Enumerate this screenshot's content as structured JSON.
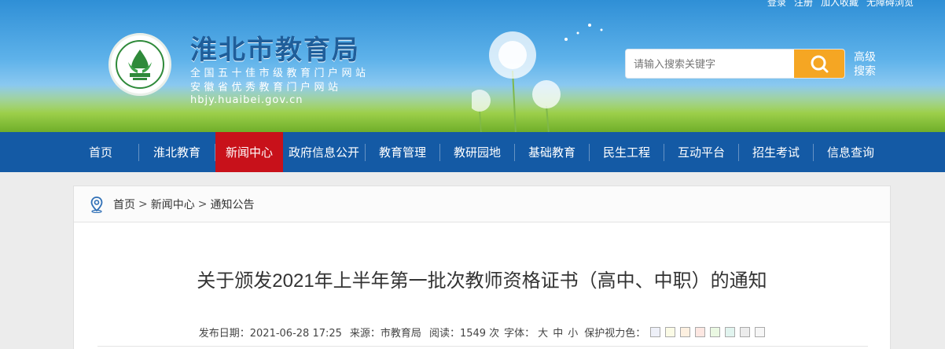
{
  "topbar": {
    "login": "登录",
    "register": "注册",
    "favorite": "加入收藏",
    "accessibility": "无障碍浏览"
  },
  "header": {
    "title": "淮北市教育局",
    "subtitle1": "全国五十佳市级教育门户网站",
    "subtitle2": "安徽省优秀教育门户网站",
    "domain": "hbjy.huaibei.gov.cn"
  },
  "search": {
    "placeholder": "请输入搜索关键字",
    "advanced": "高级搜索"
  },
  "nav": [
    {
      "label": "首页"
    },
    {
      "label": "淮北教育"
    },
    {
      "label": "新闻中心",
      "active": true
    },
    {
      "label": "政府信息公开"
    },
    {
      "label": "教育管理"
    },
    {
      "label": "教研园地"
    },
    {
      "label": "基础教育"
    },
    {
      "label": "民生工程"
    },
    {
      "label": "互动平台"
    },
    {
      "label": "招生考试"
    },
    {
      "label": "信息查询"
    }
  ],
  "breadcrumb": [
    "首页",
    "新闻中心",
    "通知公告"
  ],
  "breadcrumb_sep": ">",
  "article": {
    "title": "关于颁发2021年上半年第一批次教师资格证书（高中、中职）的通知",
    "publish_label": "发布日期：2021-06-28 17:25",
    "source_label": "来源：市教育局",
    "views_label": "阅读：1549 次",
    "font_label": "字体：",
    "font_options": [
      "大",
      "中",
      "小"
    ],
    "eye_label": "保护视力色："
  },
  "colors": {
    "nav_bg": "#145aa5",
    "nav_active": "#c8111a",
    "search_btn": "#f5a623",
    "swatches": [
      "#eef0f8",
      "#fbfbe6",
      "#fdf0e0",
      "#fde7e2",
      "#eaf8e2",
      "#e1f4ef",
      "#ececec",
      "#f6f6f6"
    ]
  }
}
